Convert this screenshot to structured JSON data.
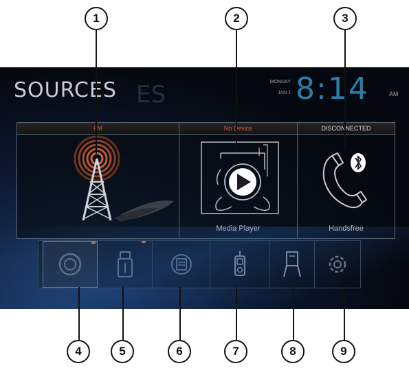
{
  "header": {
    "title": "SOURCES",
    "title_ghost": "ES",
    "day": "MONDAY",
    "date": "JAN 1",
    "time": "8:14",
    "ampm": "AM"
  },
  "sources": [
    {
      "heading": "FM",
      "label": ""
    },
    {
      "heading": "No Device",
      "label": "Media Player"
    },
    {
      "heading": "DISCONNECTED",
      "label": "Handsfree"
    }
  ],
  "bottom_bar": [
    {
      "icon": "disc-icon"
    },
    {
      "icon": "usb-icon"
    },
    {
      "icon": "sd-card-icon"
    },
    {
      "icon": "ipod-icon"
    },
    {
      "icon": "aux-input-icon"
    },
    {
      "icon": "settings-icon"
    }
  ],
  "callouts": [
    "1",
    "2",
    "3",
    "4",
    "5",
    "6",
    "7",
    "8",
    "9"
  ],
  "colors": {
    "accent_orange": "#d05c3c",
    "clock_blue": "#2c7fa8",
    "screen_bg": "#060a12"
  }
}
